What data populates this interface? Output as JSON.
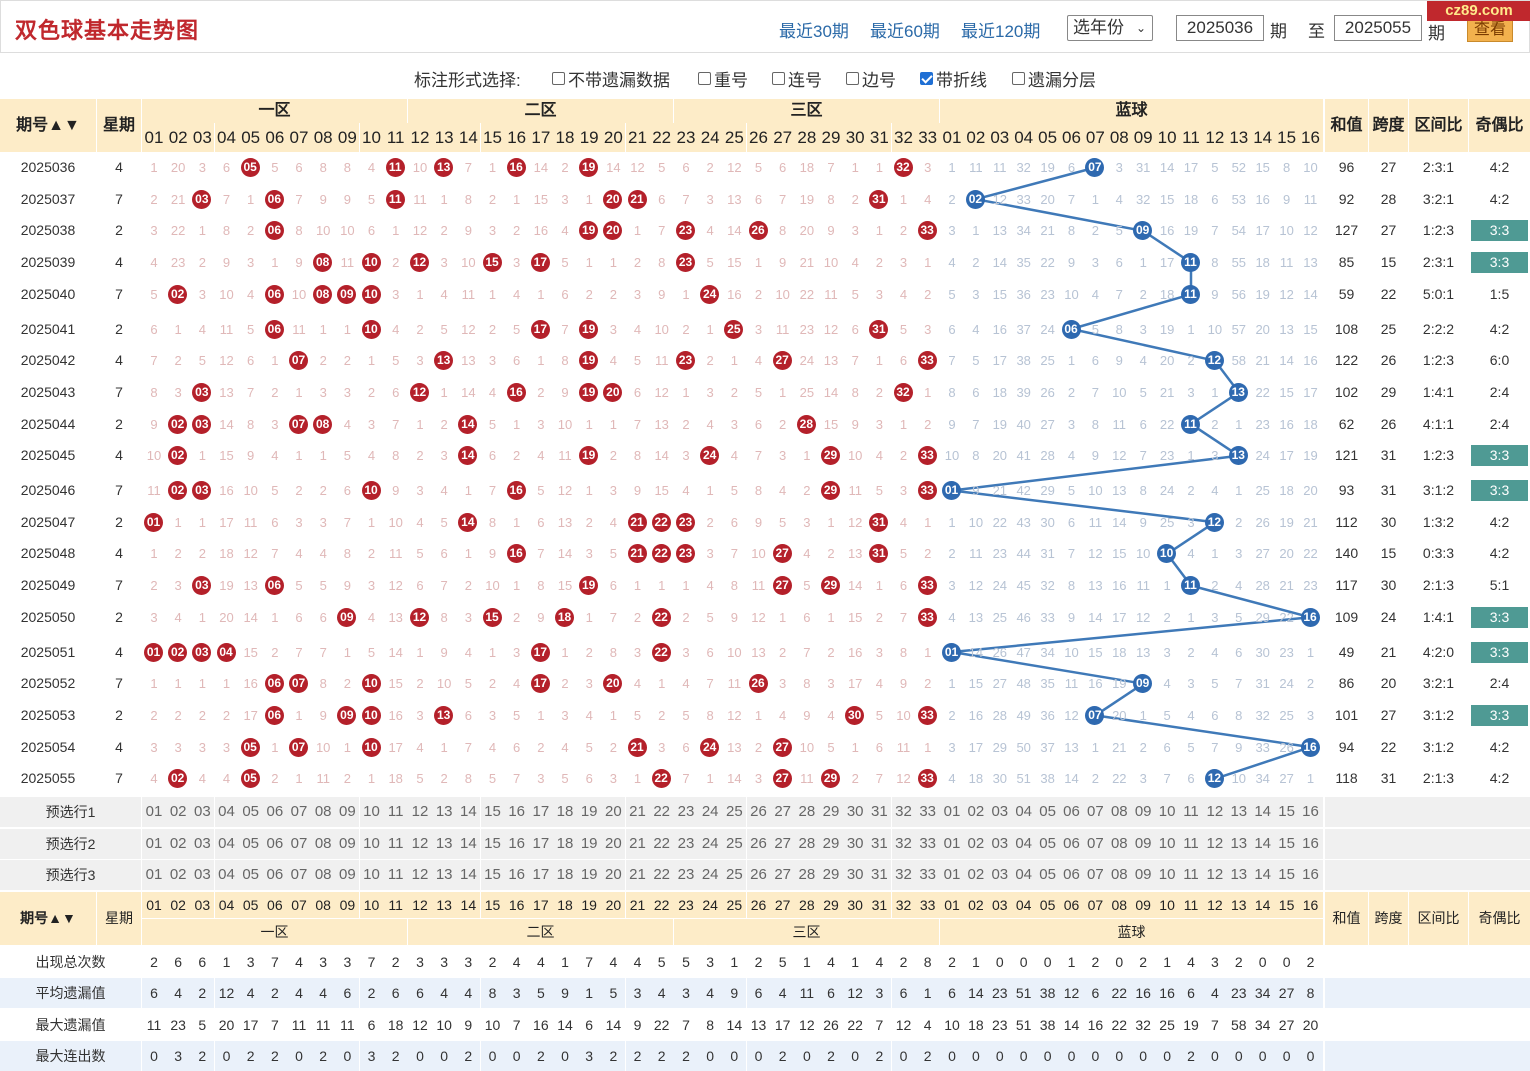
{
  "header": {
    "title": "双色球基本走势图",
    "links": [
      "最近30期",
      "最近60期",
      "最近120期"
    ],
    "year_select": "选年份",
    "from_period": "2025036",
    "period_label": "期",
    "to_label": "至",
    "to_period": "2025055",
    "period_label2": "期",
    "query_button": "查看",
    "logo": "cz89.com"
  },
  "options": {
    "label": "标注形式选择:",
    "items": [
      {
        "label": "不带遗漏数据",
        "checked": false
      },
      {
        "label": "重号",
        "checked": false
      },
      {
        "label": "连号",
        "checked": false
      },
      {
        "label": "边号",
        "checked": false
      },
      {
        "label": "带折线",
        "checked": true
      },
      {
        "label": "遗漏分层",
        "checked": false
      }
    ]
  },
  "table": {
    "col_period": "期号",
    "col_week": "星期",
    "zones": [
      "一区",
      "二区",
      "三区",
      "蓝球"
    ],
    "col_sum": "和值",
    "col_span": "跨度",
    "col_ratio": "区间比",
    "col_oddeven": "奇偶比"
  },
  "rows": [
    {
      "p": "2025036",
      "w": "4",
      "red": [
        5,
        11,
        13,
        16,
        19,
        32
      ],
      "blue": 7,
      "sum": "96",
      "span": "27",
      "ratio": "2:3:1",
      "oe": "4:2"
    },
    {
      "p": "2025037",
      "w": "7",
      "red": [
        3,
        6,
        11,
        20,
        21,
        31
      ],
      "blue": 2,
      "sum": "92",
      "span": "28",
      "ratio": "3:2:1",
      "oe": "4:2"
    },
    {
      "p": "2025038",
      "w": "2",
      "red": [
        6,
        19,
        20,
        23,
        26,
        33
      ],
      "blue": 9,
      "sum": "127",
      "span": "27",
      "ratio": "1:2:3",
      "oe": "3:3"
    },
    {
      "p": "2025039",
      "w": "4",
      "red": [
        8,
        10,
        12,
        15,
        17,
        23
      ],
      "blue": 11,
      "sum": "85",
      "span": "15",
      "ratio": "2:3:1",
      "oe": "3:3"
    },
    {
      "p": "2025040",
      "w": "7",
      "red": [
        2,
        6,
        8,
        9,
        10,
        24
      ],
      "blue": 11,
      "sum": "59",
      "span": "22",
      "ratio": "5:0:1",
      "oe": "1:5"
    },
    {
      "p": "2025041",
      "w": "2",
      "red": [
        6,
        10,
        17,
        19,
        25,
        31
      ],
      "blue": 6,
      "sum": "108",
      "span": "25",
      "ratio": "2:2:2",
      "oe": "4:2"
    },
    {
      "p": "2025042",
      "w": "4",
      "red": [
        7,
        13,
        19,
        23,
        27,
        33
      ],
      "blue": 12,
      "sum": "122",
      "span": "26",
      "ratio": "1:2:3",
      "oe": "6:0"
    },
    {
      "p": "2025043",
      "w": "7",
      "red": [
        3,
        12,
        16,
        19,
        20,
        32
      ],
      "blue": 13,
      "sum": "102",
      "span": "29",
      "ratio": "1:4:1",
      "oe": "2:4"
    },
    {
      "p": "2025044",
      "w": "2",
      "red": [
        2,
        3,
        7,
        8,
        14,
        28
      ],
      "blue": 11,
      "sum": "62",
      "span": "26",
      "ratio": "4:1:1",
      "oe": "2:4"
    },
    {
      "p": "2025045",
      "w": "4",
      "red": [
        2,
        14,
        19,
        24,
        29,
        33
      ],
      "blue": 13,
      "sum": "121",
      "span": "31",
      "ratio": "1:2:3",
      "oe": "3:3"
    },
    {
      "p": "2025046",
      "w": "7",
      "red": [
        2,
        3,
        10,
        16,
        29,
        33
      ],
      "blue": 1,
      "sum": "93",
      "span": "31",
      "ratio": "3:1:2",
      "oe": "3:3"
    },
    {
      "p": "2025047",
      "w": "2",
      "red": [
        1,
        14,
        21,
        22,
        23,
        31
      ],
      "blue": 12,
      "sum": "112",
      "span": "30",
      "ratio": "1:3:2",
      "oe": "4:2"
    },
    {
      "p": "2025048",
      "w": "4",
      "red": [
        16,
        21,
        22,
        23,
        27,
        31
      ],
      "blue": 10,
      "sum": "140",
      "span": "15",
      "ratio": "0:3:3",
      "oe": "4:2"
    },
    {
      "p": "2025049",
      "w": "7",
      "red": [
        3,
        6,
        19,
        27,
        29,
        33
      ],
      "blue": 11,
      "sum": "117",
      "span": "30",
      "ratio": "2:1:3",
      "oe": "5:1"
    },
    {
      "p": "2025050",
      "w": "2",
      "red": [
        9,
        12,
        15,
        18,
        22,
        33
      ],
      "blue": 16,
      "sum": "109",
      "span": "24",
      "ratio": "1:4:1",
      "oe": "3:3"
    },
    {
      "p": "2025051",
      "w": "4",
      "red": [
        1,
        2,
        3,
        4,
        17,
        22
      ],
      "blue": 1,
      "sum": "49",
      "span": "21",
      "ratio": "4:2:0",
      "oe": "3:3"
    },
    {
      "p": "2025052",
      "w": "7",
      "red": [
        6,
        7,
        10,
        17,
        20,
        26
      ],
      "blue": 9,
      "sum": "86",
      "span": "20",
      "ratio": "3:2:1",
      "oe": "2:4"
    },
    {
      "p": "2025053",
      "w": "2",
      "red": [
        6,
        9,
        10,
        13,
        30,
        33
      ],
      "blue": 7,
      "sum": "101",
      "span": "27",
      "ratio": "3:1:2",
      "oe": "3:3"
    },
    {
      "p": "2025054",
      "w": "4",
      "red": [
        5,
        7,
        10,
        21,
        24,
        27
      ],
      "blue": 16,
      "sum": "94",
      "span": "22",
      "ratio": "3:1:2",
      "oe": "4:2"
    },
    {
      "p": "2025055",
      "w": "7",
      "red": [
        2,
        5,
        22,
        27,
        29,
        33
      ],
      "blue": 12,
      "sum": "118",
      "span": "31",
      "ratio": "2:1:3",
      "oe": "4:2"
    }
  ],
  "preselect": [
    "预选行1",
    "预选行2",
    "预选行3"
  ],
  "stats": [
    {
      "label": "出现总次数",
      "red": [
        2,
        6,
        6,
        1,
        3,
        7,
        4,
        3,
        3,
        7,
        2,
        3,
        3,
        3,
        2,
        4,
        4,
        1,
        7,
        4,
        4,
        5,
        5,
        3,
        1,
        2,
        5,
        1,
        4,
        1,
        4,
        2,
        8
      ],
      "blue": [
        2,
        1,
        0,
        0,
        0,
        1,
        2,
        0,
        2,
        1,
        4,
        3,
        2,
        0,
        0,
        2
      ]
    },
    {
      "label": "平均遗漏值",
      "red": [
        6,
        4,
        2,
        12,
        4,
        2,
        4,
        4,
        6,
        2,
        6,
        6,
        4,
        4,
        8,
        3,
        5,
        9,
        1,
        5,
        3,
        4,
        3,
        4,
        9,
        6,
        4,
        11,
        6,
        12,
        3,
        6,
        1
      ],
      "blue": [
        6,
        14,
        23,
        51,
        38,
        12,
        6,
        22,
        16,
        16,
        6,
        4,
        23,
        34,
        27,
        8
      ]
    },
    {
      "label": "最大遗漏值",
      "red": [
        11,
        23,
        5,
        20,
        17,
        7,
        11,
        11,
        11,
        6,
        18,
        12,
        10,
        9,
        10,
        7,
        16,
        14,
        6,
        14,
        9,
        22,
        7,
        8,
        14,
        13,
        17,
        12,
        26,
        22,
        7,
        12,
        4
      ],
      "blue": [
        10,
        18,
        23,
        51,
        38,
        14,
        16,
        22,
        32,
        25,
        19,
        7,
        58,
        34,
        27,
        20
      ]
    },
    {
      "label": "最大连出数",
      "red": [
        0,
        3,
        2,
        0,
        2,
        2,
        0,
        2,
        0,
        3,
        2,
        0,
        0,
        2,
        0,
        0,
        2,
        0,
        3,
        2,
        2,
        2,
        2,
        0,
        0,
        0,
        2,
        0,
        2,
        0,
        2,
        0,
        2
      ],
      "blue": [
        0,
        0,
        0,
        0,
        0,
        0,
        0,
        0,
        0,
        0,
        2,
        0,
        0,
        0,
        0,
        0
      ]
    }
  ]
}
